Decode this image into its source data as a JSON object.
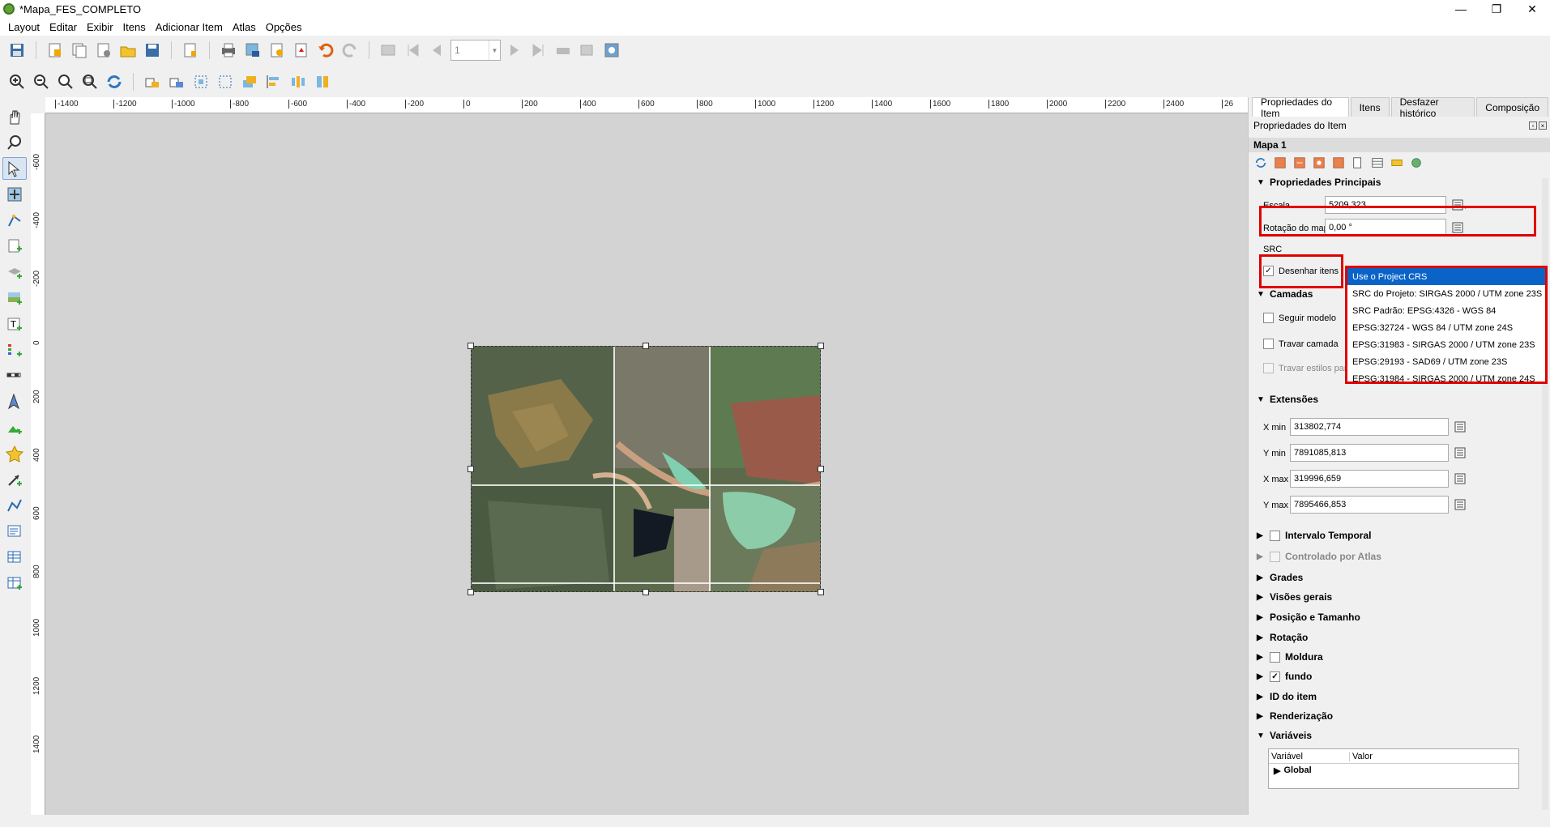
{
  "window": {
    "title": "*Mapa_FES_COMPLETO",
    "minimize": "—",
    "restore": "❐",
    "close": "✕"
  },
  "menu": [
    "Layout",
    "Editar",
    "Exibir",
    "Itens",
    "Adicionar Item",
    "Atlas",
    "Opções"
  ],
  "toolbar": {
    "page_number": "1"
  },
  "ruler": {
    "h_ticks": [
      "-1400",
      "-1200",
      "-1000",
      "-800",
      "-600",
      "-400",
      "-200",
      "0",
      "200",
      "400",
      "600",
      "800",
      "1000",
      "1200",
      "1400",
      "1600",
      "1800",
      "2000",
      "2200",
      "2400",
      "26"
    ],
    "v_ticks": [
      "-600",
      "-400",
      "-200",
      "0",
      "200",
      "400",
      "600",
      "800",
      "1000",
      "1200",
      "1400"
    ]
  },
  "panel": {
    "tabs": [
      "Propriedades do Item",
      "Itens",
      "Desfazer histórico",
      "Composição"
    ],
    "header": "Propriedades do Item",
    "item_name": "Mapa 1",
    "sections": {
      "main": "Propriedades Principais",
      "layers": "Camadas",
      "extents": "Extensões",
      "temporal": "Intervalo Temporal",
      "atlas": "Controlado por Atlas",
      "grids": "Grades",
      "overviews": "Visões gerais",
      "position": "Posição e Tamanho",
      "rotation": "Rotação",
      "frame": "Moldura",
      "background": "fundo",
      "item_id": "ID do item",
      "rendering": "Renderização",
      "variables": "Variáveis"
    },
    "scale_label": "Escala",
    "scale_value": "5209,323",
    "rotation_label": "Rotação do mapa",
    "rotation_value": "0,00 °",
    "crs_label": "SRC",
    "draw_items_label": "Desenhar itens",
    "follow_theme_label": "Seguir modelo",
    "lock_layers_label": "Travar camada",
    "lock_styles_label": "Travar estilos para as camadas",
    "xmin_label": "X min",
    "xmin": "313802,774",
    "ymin_label": "Y min",
    "ymin": "7891085,813",
    "xmax_label": "X max",
    "xmax": "319996,659",
    "ymax_label": "Y max",
    "ymax": "7895466,853",
    "vars_col1": "Variável",
    "vars_col2": "Valor",
    "vars_row": "Global"
  },
  "crs_dropdown": [
    "Use o Project CRS",
    "SRC do Projeto: SIRGAS 2000 / UTM zone 23S",
    "SRC Padrão: EPSG:4326 - WGS 84",
    "EPSG:32724 - WGS 84 / UTM zone 24S",
    "EPSG:31983 - SIRGAS 2000 / UTM zone 23S",
    "EPSG:29193 - SAD69 / UTM zone 23S",
    "EPSG:31984 - SIRGAS 2000 / UTM zone 24S"
  ],
  "colors": {
    "highlight": "#e00000",
    "selection": "#0a64c8"
  }
}
